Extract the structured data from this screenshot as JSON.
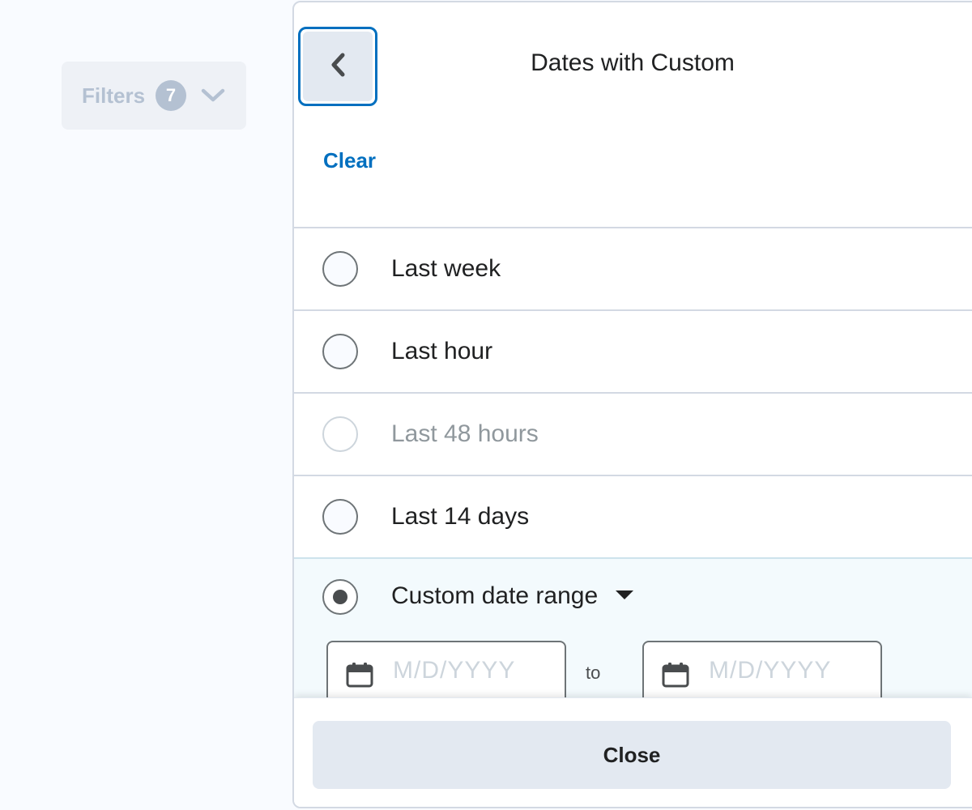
{
  "filters_button": {
    "label": "Filters",
    "count": "7",
    "icon": "chevron-down-icon"
  },
  "panel": {
    "title": "Dates with Custom",
    "back_icon": "chevron-left-icon",
    "clear_label": "Clear",
    "options": [
      {
        "label": "Last week",
        "state": "unselected"
      },
      {
        "label": "Last hour",
        "state": "unselected"
      },
      {
        "label": "Last 48 hours",
        "state": "disabled"
      },
      {
        "label": "Last 14 days",
        "state": "unselected"
      },
      {
        "label": "Custom date range",
        "state": "selected"
      }
    ],
    "custom_range": {
      "start_placeholder": "M/D/YYYY",
      "separator": "to",
      "end_placeholder": "M/D/YYYY",
      "icon": "calendar-icon"
    },
    "close_label": "Close"
  },
  "colors": {
    "accent": "#006fbf",
    "selected_row_bg": "#f3fafd",
    "button_bg": "#e3e9f1"
  }
}
